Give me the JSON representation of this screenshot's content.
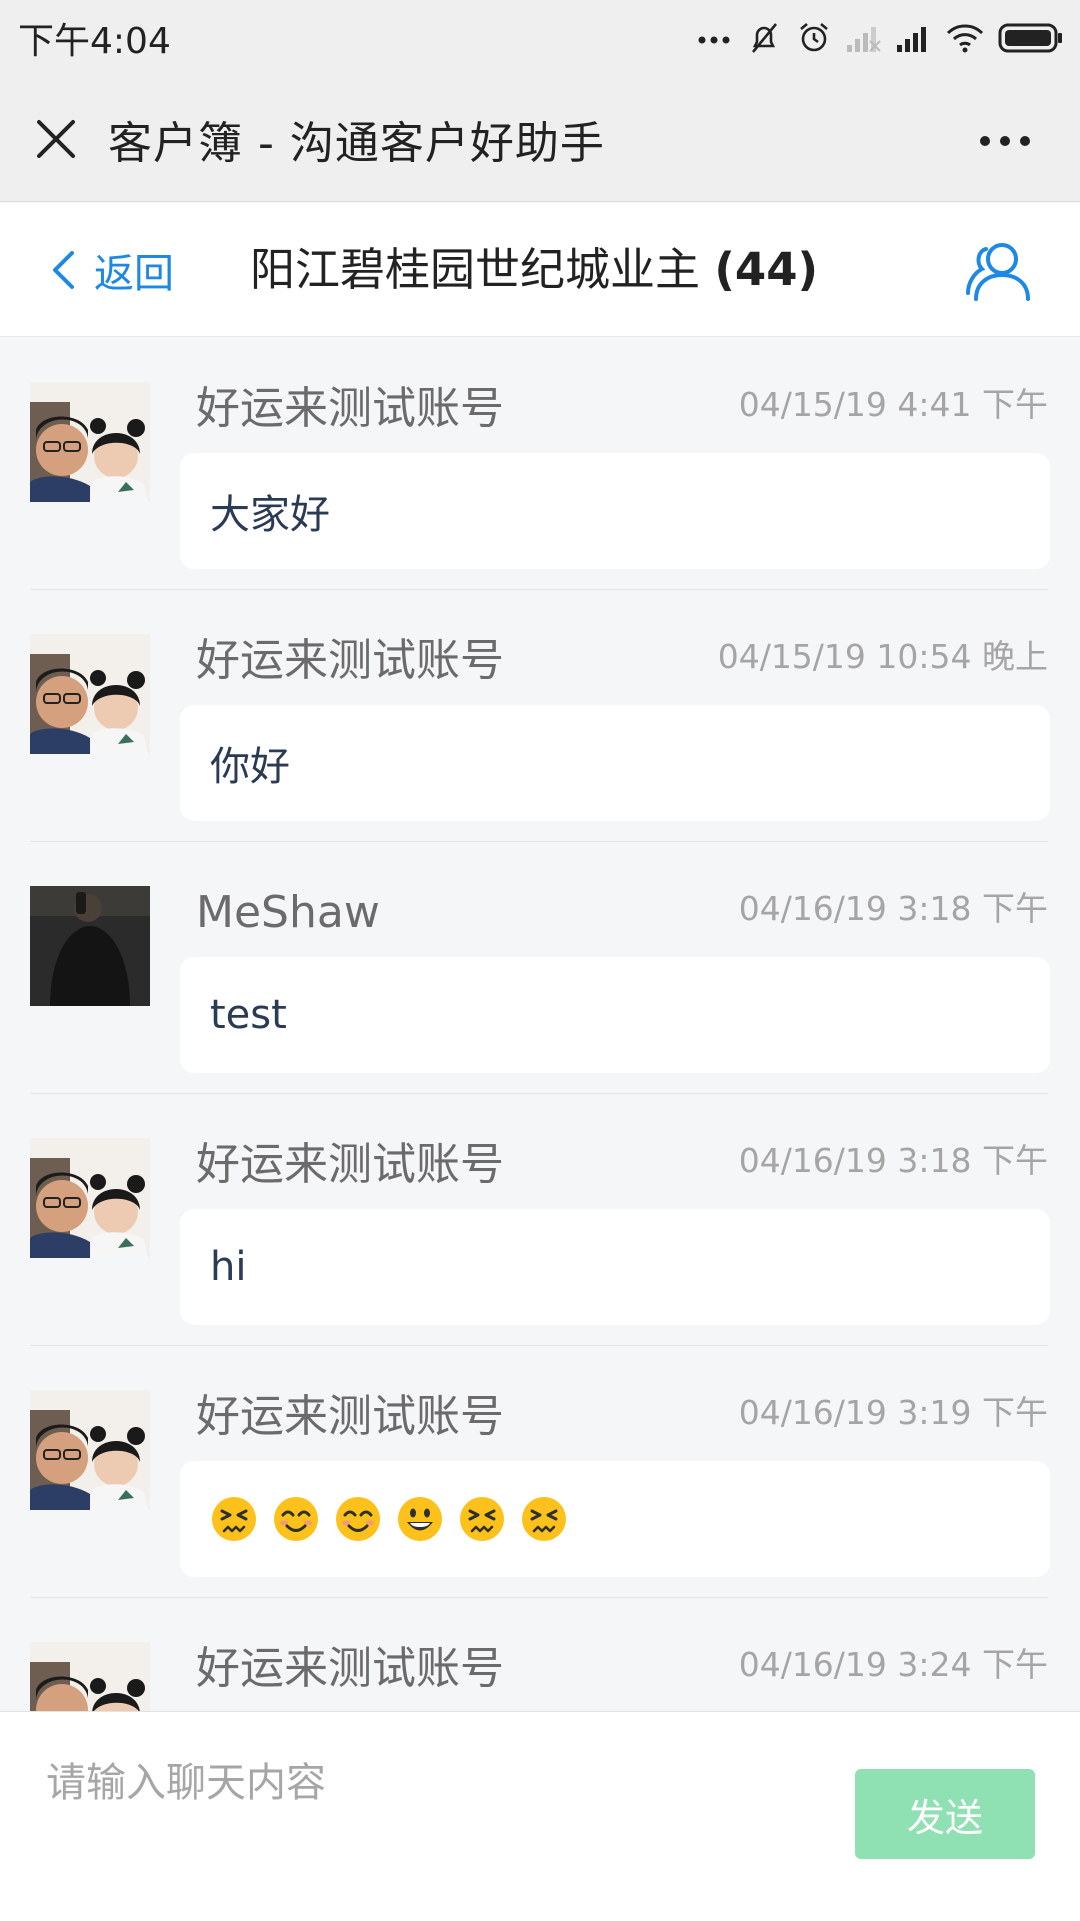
{
  "status_bar": {
    "time": "下午4:04",
    "icons": [
      "more-dots-icon",
      "mute-icon",
      "alarm-icon",
      "signal-weak-icon",
      "signal-icon",
      "wifi-icon",
      "battery-icon"
    ]
  },
  "title_bar": {
    "title": "客户簿 - 沟通客户好助手",
    "close_icon": "close-icon",
    "more_icon": "more-icon"
  },
  "header": {
    "back_label": "返回",
    "group_name": "阳江碧桂园世纪城业主",
    "member_count": "(44)",
    "members_icon": "members-icon"
  },
  "messages": [
    {
      "name": "好运来测试账号",
      "time": "04/15/19 4:41 下午",
      "text": "大家好",
      "avatar": "avatar-father-child"
    },
    {
      "name": "好运来测试账号",
      "time": "04/15/19 10:54 晚上",
      "text": "你好",
      "avatar": "avatar-father-child"
    },
    {
      "name": "MeShaw",
      "time": "04/16/19 3:18 下午",
      "text": "test",
      "avatar": "avatar-dark"
    },
    {
      "name": "好运来测试账号",
      "time": "04/16/19 3:18 下午",
      "text": "hi",
      "avatar": "avatar-father-child"
    },
    {
      "name": "好运来测试账号",
      "time": "04/16/19 3:19 下午",
      "text": "",
      "emojis": [
        "persevering-face",
        "smiling-face",
        "smiling-face",
        "grinning-face",
        "persevering-face",
        "persevering-face"
      ],
      "avatar": "avatar-father-child"
    },
    {
      "name": "好运来测试账号",
      "time": "04/16/19 3:24 下午",
      "text": "",
      "avatar": "avatar-father-child"
    }
  ],
  "input": {
    "placeholder": "请输入聊天内容",
    "value": "",
    "send_label": "发送",
    "send_color": "#8fe0b3"
  },
  "colors": {
    "accent": "#1e88e5",
    "bubble": "#ffffff",
    "background": "#f5f6f8"
  }
}
